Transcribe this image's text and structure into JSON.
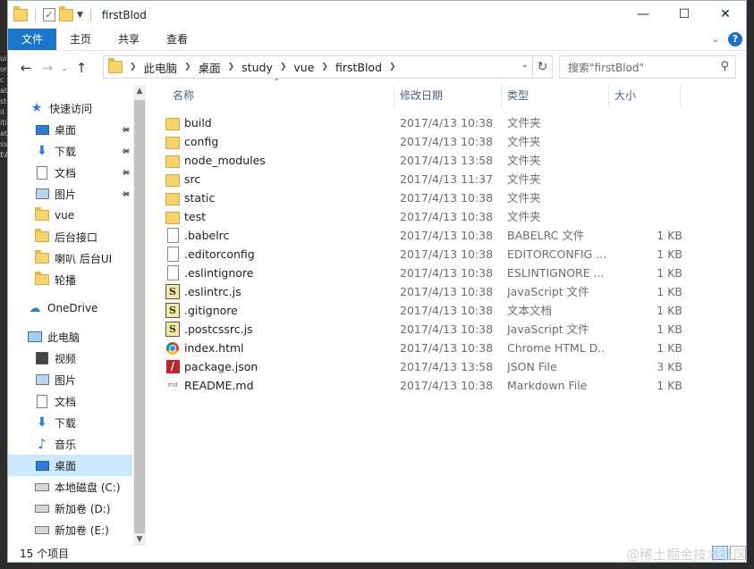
{
  "window": {
    "title": "firstBlod"
  },
  "titlebar": {
    "minimize": "—",
    "maximize": "☐",
    "close": "✕"
  },
  "ribbon": {
    "tabs": [
      "文件",
      "主页",
      "共享",
      "查看"
    ]
  },
  "address": {
    "crumbs": [
      "此电脑",
      "桌面",
      "study",
      "vue",
      "firstBlod"
    ],
    "search_placeholder": "搜索\"firstBlod\""
  },
  "nav": {
    "quick_access": "快速访问",
    "items": [
      {
        "label": "快速访问",
        "icon": "star-icon"
      },
      {
        "label": "桌面",
        "icon": "desktop-icon",
        "pinned": true
      },
      {
        "label": "下载",
        "icon": "download-icon",
        "pinned": true
      },
      {
        "label": "文档",
        "icon": "document-icon",
        "pinned": true
      },
      {
        "label": "图片",
        "icon": "pictures-icon",
        "pinned": true
      },
      {
        "label": "vue",
        "icon": "folder-icon"
      },
      {
        "label": "后台接口",
        "icon": "folder-icon"
      },
      {
        "label": "喇叭 后台UI",
        "icon": "folder-icon"
      },
      {
        "label": "轮播",
        "icon": "folder-icon"
      },
      {
        "label": "OneDrive",
        "icon": "onedrive-icon"
      },
      {
        "label": "此电脑",
        "icon": "this-pc-icon"
      },
      {
        "label": "视频",
        "icon": "videos-icon"
      },
      {
        "label": "图片",
        "icon": "pictures-icon"
      },
      {
        "label": "文档",
        "icon": "document-icon"
      },
      {
        "label": "下载",
        "icon": "download-icon"
      },
      {
        "label": "音乐",
        "icon": "music-icon"
      },
      {
        "label": "桌面",
        "icon": "desktop-icon",
        "selected": true
      },
      {
        "label": "本地磁盘 (C:)",
        "icon": "drive-icon"
      },
      {
        "label": "新加卷 (D:)",
        "icon": "drive-icon"
      },
      {
        "label": "新加卷 (E:)",
        "icon": "drive-icon"
      }
    ]
  },
  "columns": {
    "name": "名称",
    "date": "修改日期",
    "type": "类型",
    "size": "大小"
  },
  "files": [
    {
      "name": "build",
      "date": "2017/4/13 10:38",
      "type": "文件夹",
      "size": "",
      "icon": "folder"
    },
    {
      "name": "config",
      "date": "2017/4/13 10:38",
      "type": "文件夹",
      "size": "",
      "icon": "folder"
    },
    {
      "name": "node_modules",
      "date": "2017/4/13 13:58",
      "type": "文件夹",
      "size": "",
      "icon": "folder"
    },
    {
      "name": "src",
      "date": "2017/4/13 11:37",
      "type": "文件夹",
      "size": "",
      "icon": "folder"
    },
    {
      "name": "static",
      "date": "2017/4/13 10:38",
      "type": "文件夹",
      "size": "",
      "icon": "folder"
    },
    {
      "name": "test",
      "date": "2017/4/13 10:38",
      "type": "文件夹",
      "size": "",
      "icon": "folder"
    },
    {
      "name": ".babelrc",
      "date": "2017/4/13 10:38",
      "type": "BABELRC 文件",
      "size": "1 KB",
      "icon": "file"
    },
    {
      "name": ".editorconfig",
      "date": "2017/4/13 10:38",
      "type": "EDITORCONFIG ...",
      "size": "1 KB",
      "icon": "file"
    },
    {
      "name": ".eslintignore",
      "date": "2017/4/13 10:38",
      "type": "ESLINTIGNORE ...",
      "size": "1 KB",
      "icon": "file"
    },
    {
      "name": ".eslintrc.js",
      "date": "2017/4/13 10:38",
      "type": "JavaScript 文件",
      "size": "1 KB",
      "icon": "js"
    },
    {
      "name": ".gitignore",
      "date": "2017/4/13 10:38",
      "type": "文本文档",
      "size": "1 KB",
      "icon": "js"
    },
    {
      "name": ".postcssrc.js",
      "date": "2017/4/13 10:38",
      "type": "JavaScript 文件",
      "size": "1 KB",
      "icon": "js"
    },
    {
      "name": "index.html",
      "date": "2017/4/13 10:38",
      "type": "Chrome HTML D...",
      "size": "1 KB",
      "icon": "chrome"
    },
    {
      "name": "package.json",
      "date": "2017/4/13 13:58",
      "type": "JSON File",
      "size": "3 KB",
      "icon": "json"
    },
    {
      "name": "README.md",
      "date": "2017/4/13 10:38",
      "type": "Markdown File",
      "size": "1 KB",
      "icon": "md"
    }
  ],
  "status": {
    "count": "15 个项目"
  },
  "watermark": "@稀土掘金技术社区",
  "colors": {
    "accent": "#1a75cc",
    "selected": "#cce8ff",
    "folder": "#f7d46b"
  }
}
